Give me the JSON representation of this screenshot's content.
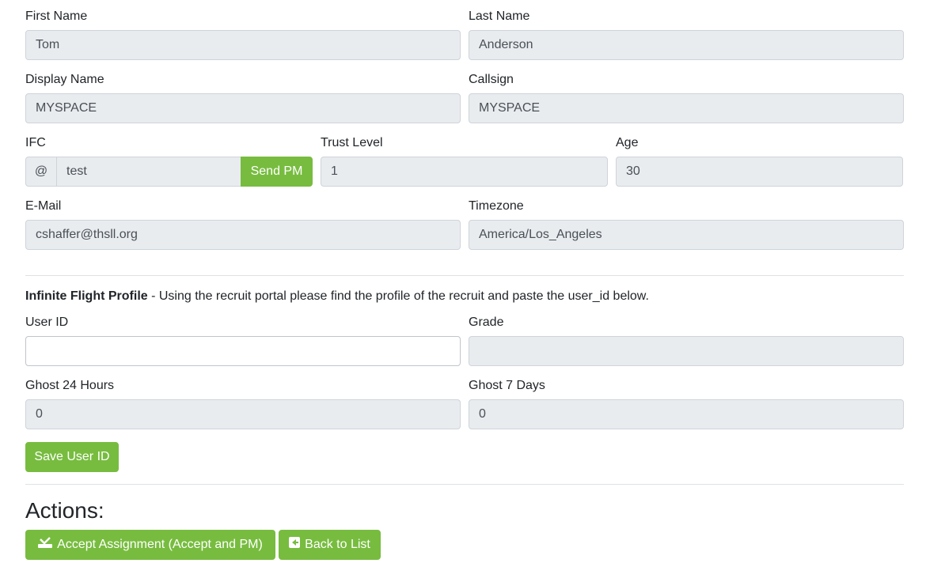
{
  "fields": {
    "first_name": {
      "label": "First Name",
      "value": "Tom"
    },
    "last_name": {
      "label": "Last Name",
      "value": "Anderson"
    },
    "display_name": {
      "label": "Display Name",
      "value": "MYSPACE"
    },
    "callsign": {
      "label": "Callsign",
      "value": "MYSPACE"
    },
    "ifc": {
      "label": "IFC",
      "prefix": "@",
      "value": "test",
      "button": "Send PM"
    },
    "trust_level": {
      "label": "Trust Level",
      "value": "1"
    },
    "age": {
      "label": "Age",
      "value": "30"
    },
    "email": {
      "label": "E-Mail",
      "value": "cshaffer@thsll.org"
    },
    "timezone": {
      "label": "Timezone",
      "value": "America/Los_Angeles"
    }
  },
  "if_profile": {
    "title": "Infinite Flight Profile",
    "description": " - Using the recruit portal please find the profile of the recruit and paste the user_id below.",
    "user_id": {
      "label": "User ID",
      "value": ""
    },
    "grade": {
      "label": "Grade",
      "value": ""
    },
    "ghost_24h": {
      "label": "Ghost 24 Hours",
      "value": "0"
    },
    "ghost_7d": {
      "label": "Ghost 7 Days",
      "value": "0"
    },
    "save_button": "Save User ID"
  },
  "actions": {
    "heading": "Actions:",
    "accept_button": "Accept Assignment (Accept and PM)",
    "back_button": "Back to List"
  },
  "colors": {
    "accent": "#77bc3f",
    "field_bg": "#e9ecef",
    "border": "#ced4da"
  }
}
